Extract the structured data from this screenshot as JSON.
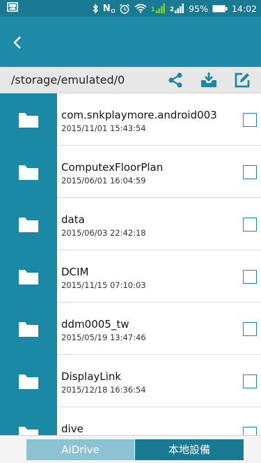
{
  "status_bar": {
    "battery_text": "95%",
    "time": "14:02",
    "nfc_label": "N",
    "sim1_label": "1",
    "sim2_label": "2"
  },
  "path_bar": {
    "path": "/storage/emulated/0"
  },
  "files": [
    {
      "name": "com.snkplaymore.android003",
      "date": "2015/11/01 15:43:54"
    },
    {
      "name": "ComputexFloorPlan",
      "date": "2015/06/01 16:04:59"
    },
    {
      "name": "data",
      "date": "2015/06/03 22:42:18"
    },
    {
      "name": "DCIM",
      "date": "2015/11/15 07:10:03"
    },
    {
      "name": "ddm0005_tw",
      "date": "2015/05/19 13:47:46"
    },
    {
      "name": "DisplayLink",
      "date": "2015/12/18 16:36:54"
    },
    {
      "name": "dive",
      "date": ""
    }
  ],
  "bottom_tabs": {
    "aidrive": "AiDrive",
    "local": "本地設備"
  },
  "colors": {
    "app_bar": "#1f8ba8",
    "status_bar": "#1b7a93",
    "folder_thumb": "#1b88a6",
    "tab_inactive": "#8cc3d2",
    "tab_active": "#1b7a93",
    "signal_green": "#7ed321"
  }
}
